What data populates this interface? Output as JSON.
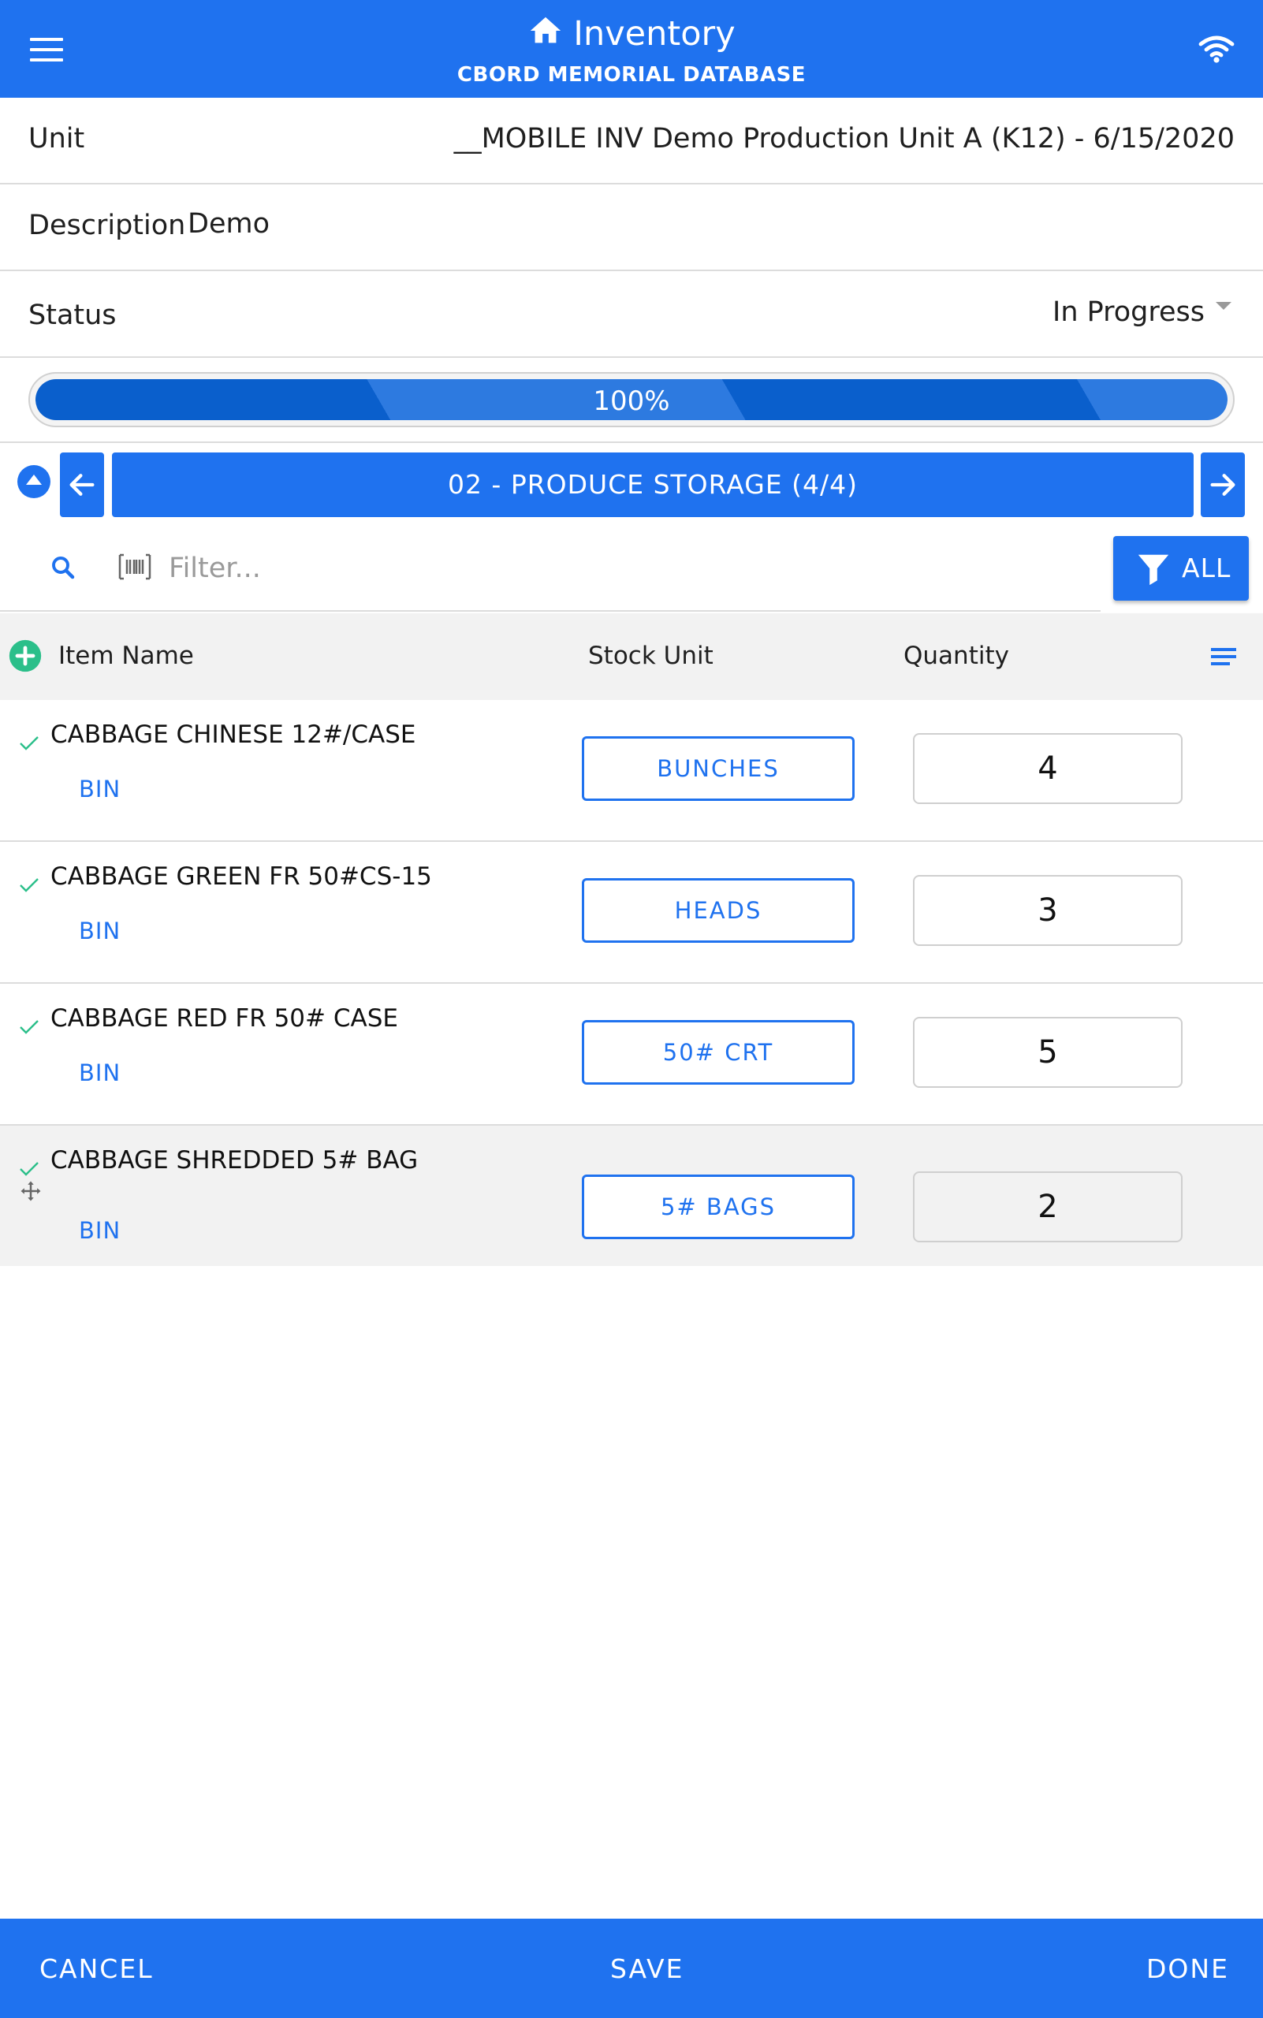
{
  "header": {
    "title": "Inventory",
    "subtitle": "CBORD MEMORIAL DATABASE",
    "icons": {
      "menu": "hamburger-icon",
      "home": "home-icon",
      "connection": "wifi-icon"
    }
  },
  "form": {
    "unit_label": "Unit",
    "unit_value": "__MOBILE INV Demo Production Unit A (K12) - 6/15/2020",
    "description_label": "Description",
    "description_value": "Demo",
    "status_label": "Status",
    "status_value": "In Progress"
  },
  "progress": {
    "value": 1.0,
    "label": "100%"
  },
  "storage_nav": {
    "label": "02 - PRODUCE STORAGE (4/4)"
  },
  "filter": {
    "placeholder": "Filter...",
    "value": "",
    "all_label": "ALL"
  },
  "table": {
    "columns": [
      "Item Name",
      "Stock Unit",
      "Quantity"
    ],
    "rows": [
      {
        "name": "CABBAGE CHINESE 12#/CASE",
        "bin": "BIN",
        "stock_unit": "BUNCHES",
        "quantity": "4",
        "checked": true
      },
      {
        "name": "CABBAGE GREEN FR 50#CS-15",
        "bin": "BIN",
        "stock_unit": "HEADS",
        "quantity": "3",
        "checked": true
      },
      {
        "name": "CABBAGE RED FR 50# CASE",
        "bin": "BIN",
        "stock_unit": "50# CRT",
        "quantity": "5",
        "checked": true
      },
      {
        "name": "CABBAGE SHREDDED 5# BAG",
        "bin": "BIN",
        "stock_unit": "5# BAGS",
        "quantity": "2",
        "checked": true,
        "selected": true
      }
    ]
  },
  "footer": {
    "cancel": "CANCEL",
    "save": "SAVE",
    "done": "DONE"
  },
  "colors": {
    "primary": "#1f72ef",
    "check": "#2bbf8a",
    "row_selected": "#f2f2f2"
  }
}
